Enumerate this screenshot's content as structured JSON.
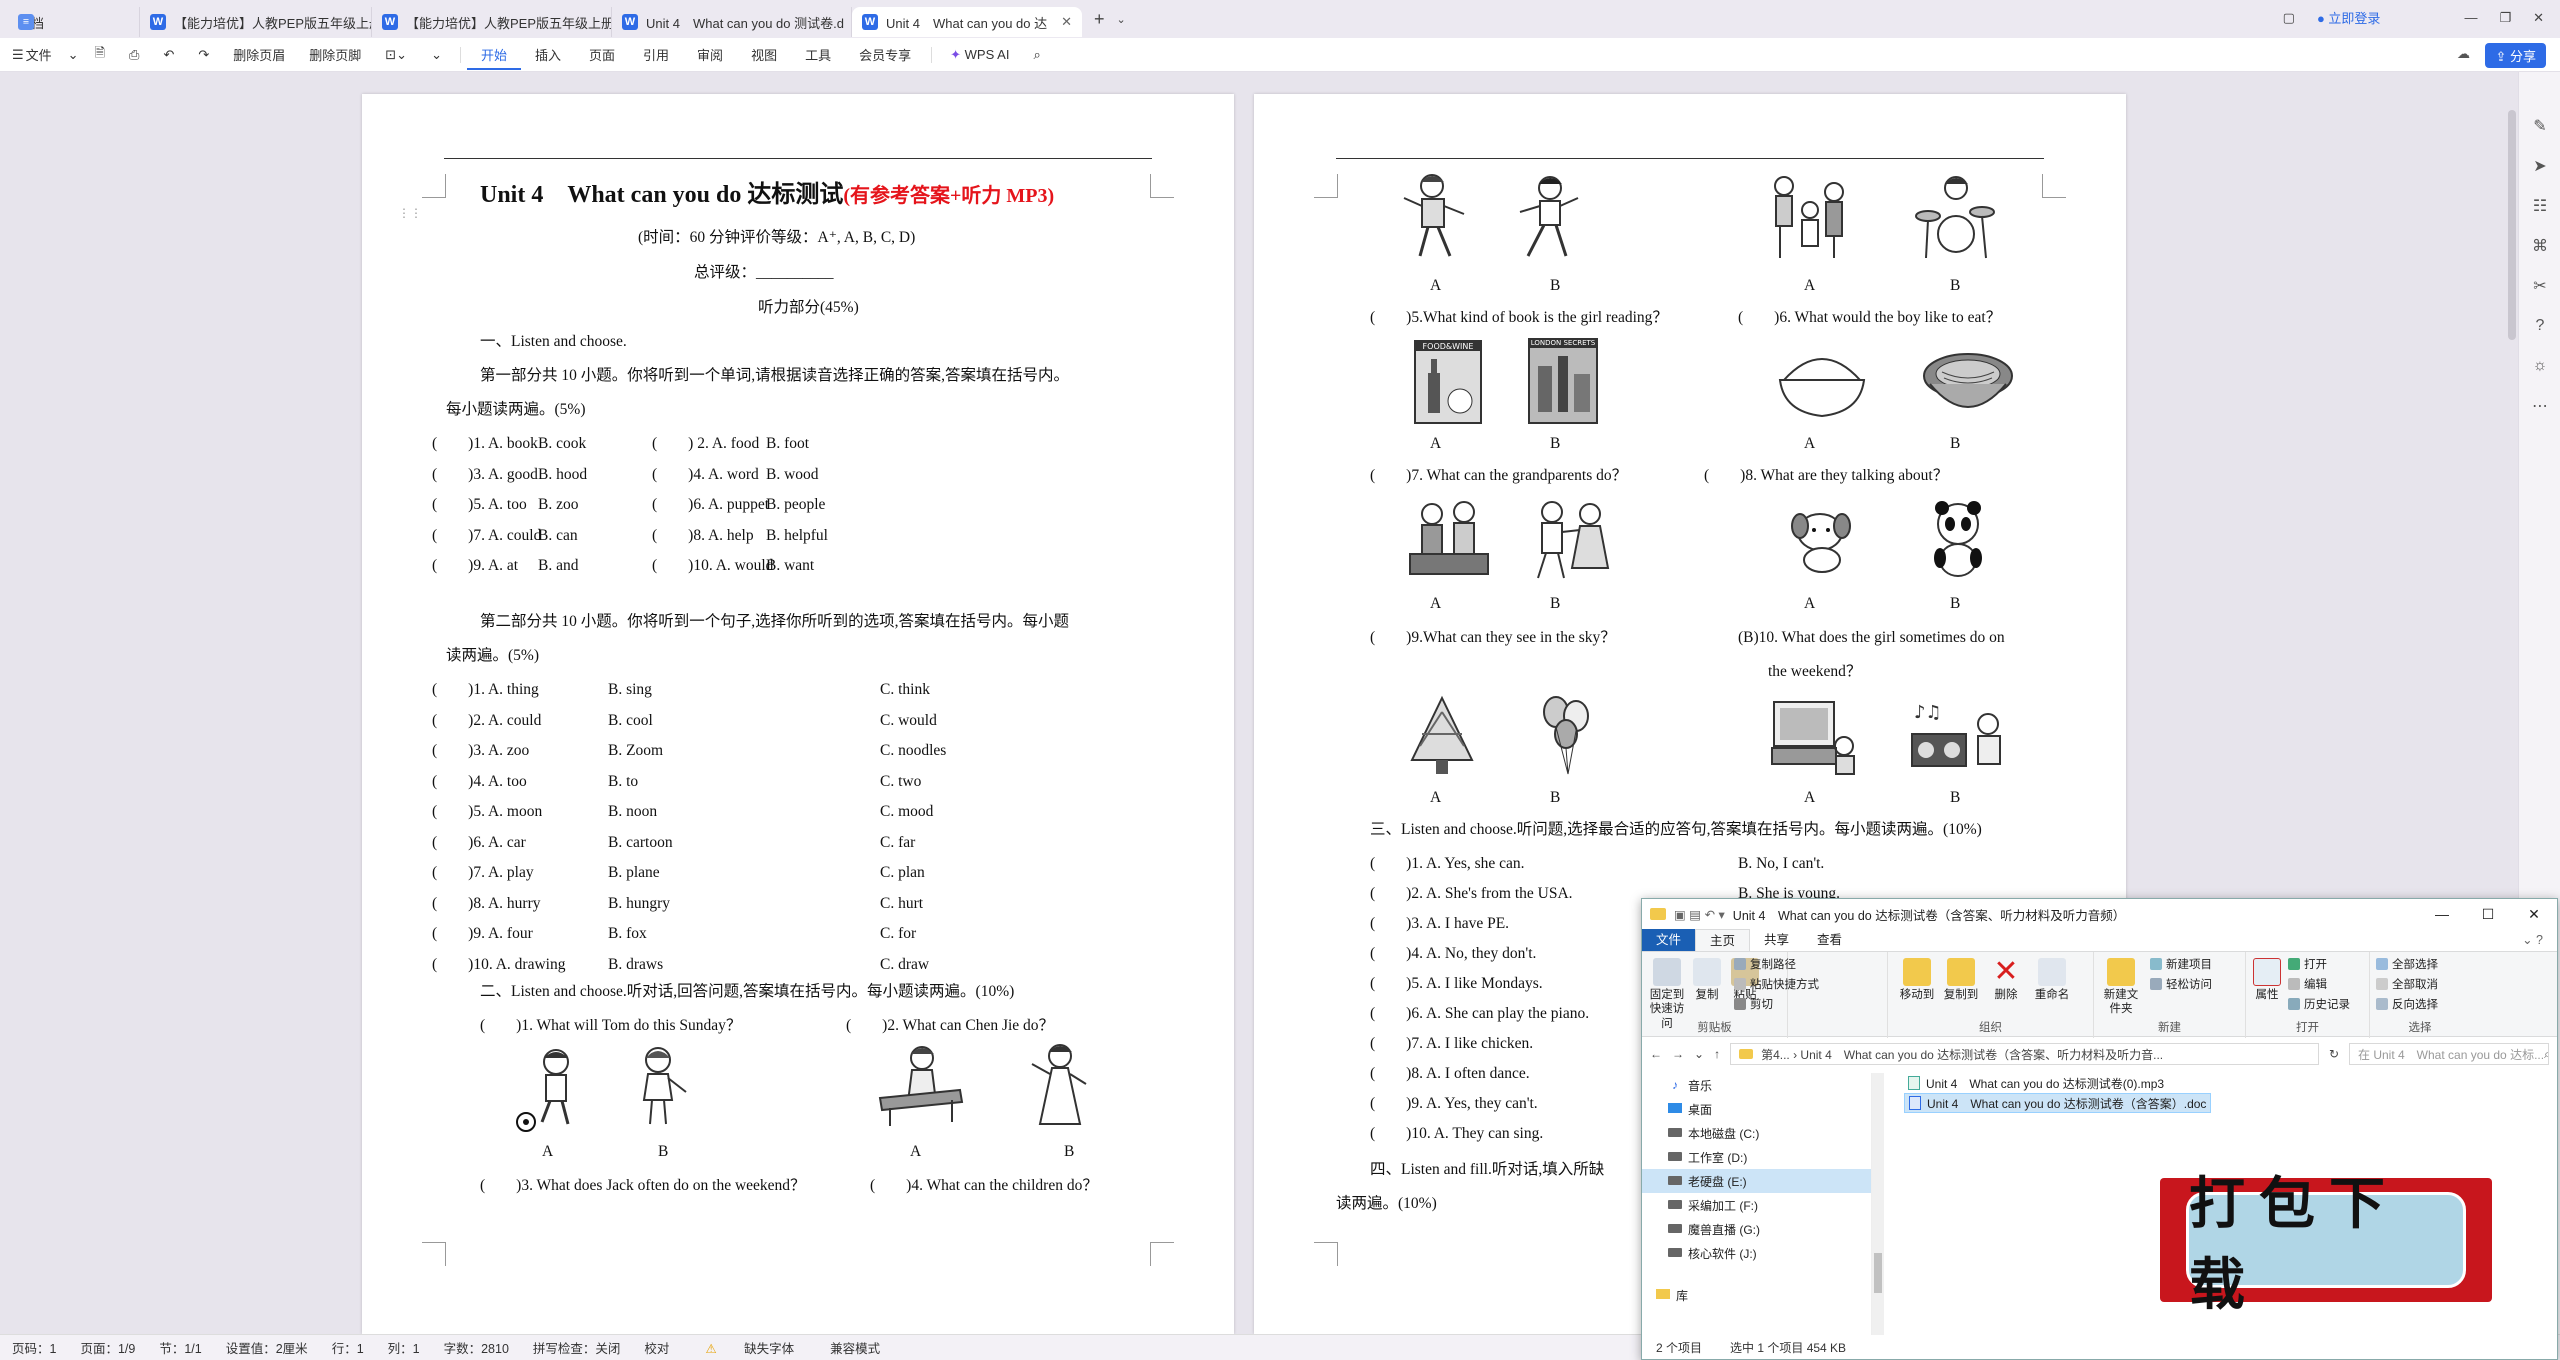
{
  "tabs": [
    {
      "label": "文档",
      "icon": "doc-icon"
    },
    {
      "label": "【能力培优】人教PEP版五年级上册英",
      "icon": "word-icon"
    },
    {
      "label": "【能力培优】人教PEP版五年级上册英",
      "icon": "word-icon"
    },
    {
      "label": "Unit 4　What can you do 测试卷.d",
      "icon": "word-icon"
    },
    {
      "label": "Unit 4　What can you do 达",
      "icon": "word-icon",
      "active": true
    }
  ],
  "titlebar": {
    "login": "立即登录"
  },
  "toolbar": {
    "file": "文件",
    "delete_header": "删除页眉",
    "delete_footer": "删除页脚",
    "menus": [
      "开始",
      "插入",
      "页面",
      "引用",
      "审阅",
      "视图",
      "工具",
      "会员专享"
    ],
    "wps_ai": "WPS AI",
    "share": "分享"
  },
  "page1": {
    "title_main": "Unit 4　What can you do  达标测试",
    "title_red": "(有参考答案+听力 MP3)",
    "time_line": "(时间：60 分钟评价等级：A⁺, A, B, C, D)",
    "score_line": "总评级：__________",
    "listening": "听力部分(45%)",
    "s1_title": "一、Listen and choose.",
    "s1_part1a": "第一部分共 10 小题。你将听到一个单词,请根据读音选择正确的答案,答案填在括号内。",
    "s1_part1b": "每小题读两遍。(5%)",
    "part1_rows": [
      [
        "(　　)1. A. book",
        "B. cook",
        "(　　) 2. A. food",
        "B.  foot"
      ],
      [
        "(　　)3. A. good",
        "B. hood",
        "(　　)4. A. word",
        "B. wood"
      ],
      [
        "(　　)5. A. too",
        "B. zoo",
        "(　　)6. A. puppet",
        "B. people"
      ],
      [
        "(　　)7. A. could",
        "B. can",
        "(　　)8. A. help",
        "B. helpful"
      ],
      [
        "(　　)9. A. at",
        "B. and",
        "(　　)10. A. would",
        "B. want"
      ]
    ],
    "s1_part2a": "第二部分共 10 小题。你将听到一个句子,选择你所听到的选项,答案填在括号内。每小题",
    "s1_part2b": "读两遍。(5%)",
    "part2_rows": [
      [
        "(　　)1. A. thing",
        "B. sing",
        "C. think"
      ],
      [
        "(　　)2. A. could",
        "B. cool",
        "C. would"
      ],
      [
        "(　　)3. A. zoo",
        "B. Zoom",
        "C. noodles"
      ],
      [
        "(　　)4. A. too",
        "B. to",
        "C. two"
      ],
      [
        "(　　)5. A. moon",
        "B. noon",
        "C. mood"
      ],
      [
        "(　　)6. A. car",
        "B. cartoon",
        "C. far"
      ],
      [
        "(　　)7. A. play",
        "B. plane",
        "C. plan"
      ],
      [
        "(　　)8. A. hurry",
        "B. hungry",
        "C. hurt"
      ],
      [
        "(　　)9. A. four",
        "B. fox",
        "C. for"
      ],
      [
        "(　　)10. A. drawing",
        "B. draws",
        "C. draw"
      ]
    ],
    "s2_title": "二、Listen and choose.听对话,回答问题,答案填在括号内。每小题读两遍。(10%)",
    "q1": "(　　)1. What will Tom do this Sunday？",
    "q2": "(　　)2. What can Chen Jie do？",
    "q3": "(　　)3. What does Jack often do on the weekend？",
    "q4": "(　　)4. What can the children do？",
    "opt_a": "A",
    "opt_b": "B"
  },
  "page2": {
    "q5": "(　　)5.What kind of book is the girl reading？",
    "q6": "(　　)6. What would the boy like to eat？",
    "q7": "(　　)7. What can the grandparents do？",
    "q8": "(　　)8. What are they talking about？",
    "q9": "(　　)9.What can they see in the sky？",
    "q10a": "(B)10. What does the girl sometimes do on",
    "q10b": "the weekend？",
    "food_label": "FOOD&WINE",
    "london_label": "LONDON SECRETS",
    "s3_title": "三、Listen and choose.听问题,选择最合适的应答句,答案填在括号内。每小题读两遍。(10%)",
    "s3_rows": [
      [
        "(　　)1. A. Yes, she can.",
        "B. No, I can't."
      ],
      [
        "(　　)2. A. She's from the USA.",
        "B. She is young."
      ],
      [
        "(　　)3. A. I have PE.",
        ""
      ],
      [
        "(　　)4. A. No, they don't.",
        ""
      ],
      [
        "(　　)5. A. I like Mondays.",
        ""
      ],
      [
        "(　　)6. A. She can play the piano.",
        ""
      ],
      [
        "(　　)7. A. I like chicken.",
        ""
      ],
      [
        "(　　)8. A. I often dance.",
        ""
      ],
      [
        "(　　)9. A. Yes, they can't.",
        ""
      ],
      [
        "(　　)10. A. They can sing.",
        ""
      ]
    ],
    "s4_title": "四、Listen and fill.听对话,填入所缺",
    "s4_line2": "读两遍。(10%)",
    "opt_a": "A",
    "opt_b": "B"
  },
  "status": {
    "page": "页码：1",
    "pages": "页面：1/9",
    "section": "节：1/1",
    "setting": "设置值：2厘米",
    "row": "行：1",
    "col": "列：1",
    "words": "字数：2810",
    "spell": "拼写检查：关闭",
    "proof": "校对",
    "missing_font": "缺失字体",
    "compat": "兼容模式"
  },
  "explorer": {
    "title": "Unit 4　What can you do 达标测试卷（含答案、听力材料及听力音频）",
    "menu": [
      "文件",
      "主页",
      "共享",
      "查看"
    ],
    "ribbon": {
      "pin": "固定到快速访问",
      "copy": "复制",
      "paste": "粘贴",
      "copy_path": "复制路径",
      "paste_shortcut": "粘贴快捷方式",
      "cut": "剪切",
      "g_clipboard": "剪贴板",
      "move_to": "移动到",
      "copy_to": "复制到",
      "delete": "删除",
      "rename": "重命名",
      "g_organize": "组织",
      "new_folder": "新建文件夹",
      "new_item": "新建项目",
      "easy_access": "轻松访问",
      "g_new": "新建",
      "properties": "属性",
      "open": "打开",
      "edit": "编辑",
      "history": "历史记录",
      "g_open": "打开",
      "select_all": "全部选择",
      "select_none": "全部取消",
      "invert": "反向选择",
      "g_select": "选择"
    },
    "address": "第4...  ›  Unit 4　What can you do 达标测试卷（含答案、听力材料及听力音...",
    "search_placeholder": "在 Unit 4　What can you do 达标...",
    "nav": [
      {
        "label": "音乐",
        "icon": "music-icon"
      },
      {
        "label": "桌面",
        "icon": "desktop-icon"
      },
      {
        "label": "本地磁盘 (C:)",
        "icon": "drive-icon"
      },
      {
        "label": "工作室 (D:)",
        "icon": "drive-icon"
      },
      {
        "label": "老硬盘 (E:)",
        "icon": "drive-icon",
        "selected": true
      },
      {
        "label": "采编加工 (F:)",
        "icon": "drive-icon"
      },
      {
        "label": "魔兽直播 (G:)",
        "icon": "drive-icon"
      },
      {
        "label": "核心软件 (J:)",
        "icon": "drive-icon"
      },
      {
        "label": "库",
        "icon": "library-icon"
      }
    ],
    "files": [
      {
        "name": "Unit 4　What can you do 达标测试卷(0).mp3",
        "icon": "audio-file-icon"
      },
      {
        "name": "Unit 4　What can you do 达标测试卷（含答案）.doc",
        "icon": "word-file-icon",
        "selected": true
      }
    ],
    "status_items": "2 个项目",
    "status_selected": "选中 1 个项目  454 KB"
  },
  "banner": {
    "text": "打包下载"
  }
}
